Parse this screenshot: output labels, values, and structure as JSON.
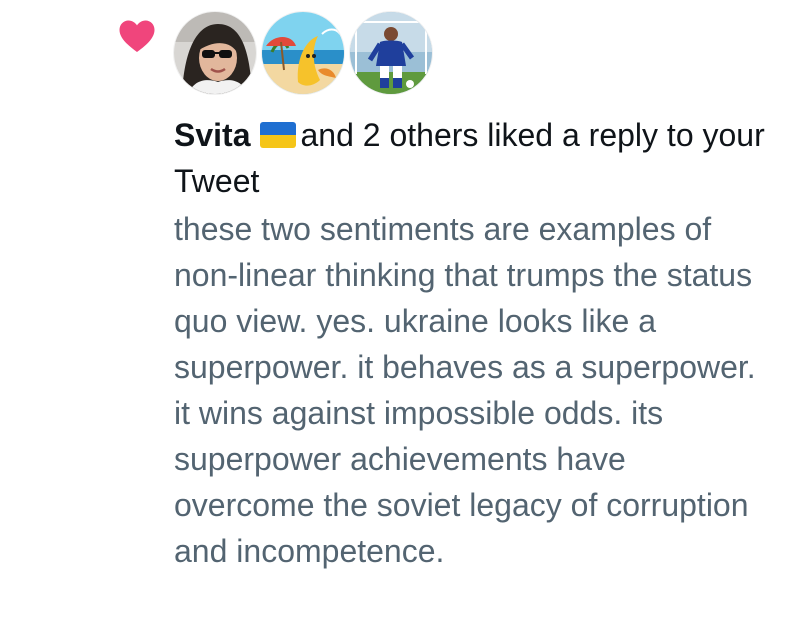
{
  "notification": {
    "icon": "heart-icon",
    "accent_color": "#f91880",
    "avatars": [
      {
        "name": "avatar-user-sunglasses"
      },
      {
        "name": "avatar-user-beach-banana"
      },
      {
        "name": "avatar-user-football-player"
      }
    ],
    "user_name": "Svita",
    "flag": "ukraine-flag-emoji",
    "action_text": "and 2 others liked a reply to your Tweet",
    "reply_text": "these two sentiments are examples of non-linear thinking that trumps the status quo view. yes. ukraine looks like a superpower. it behaves as a superpower. it wins against impossible odds. its superpower achievements have overcome the soviet legacy of corruption and incompetence."
  }
}
